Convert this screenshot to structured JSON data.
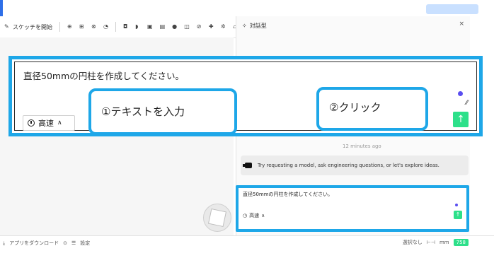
{
  "toolbar": {
    "sketch_label": "スケッチを開始"
  },
  "side_panel": {
    "title": "対話型",
    "close_icon": "close-icon",
    "timestamp": "12 minutes ago",
    "suggestion": "Try requesting a model, ask engineering questions, or let's explore ideas."
  },
  "composer": {
    "text": "直径50mmの円柱を作成してください。",
    "speed_label": "高速",
    "send_icon": "↑"
  },
  "mini_composer": {
    "text": "直径50mmの円柱を作成してください。",
    "speed_label": "高速"
  },
  "callouts": {
    "step1": "①テキストを入力",
    "step2": "②クリック"
  },
  "statusbar": {
    "download_app": "アプリをダウンロード",
    "settings": "設定",
    "selection": "選択なし",
    "unit": "mm",
    "chip": "758"
  },
  "colors": {
    "callout_border": "#1ea7e8",
    "send_button": "#2de08a",
    "purple_dot": "#5a4ef0"
  }
}
